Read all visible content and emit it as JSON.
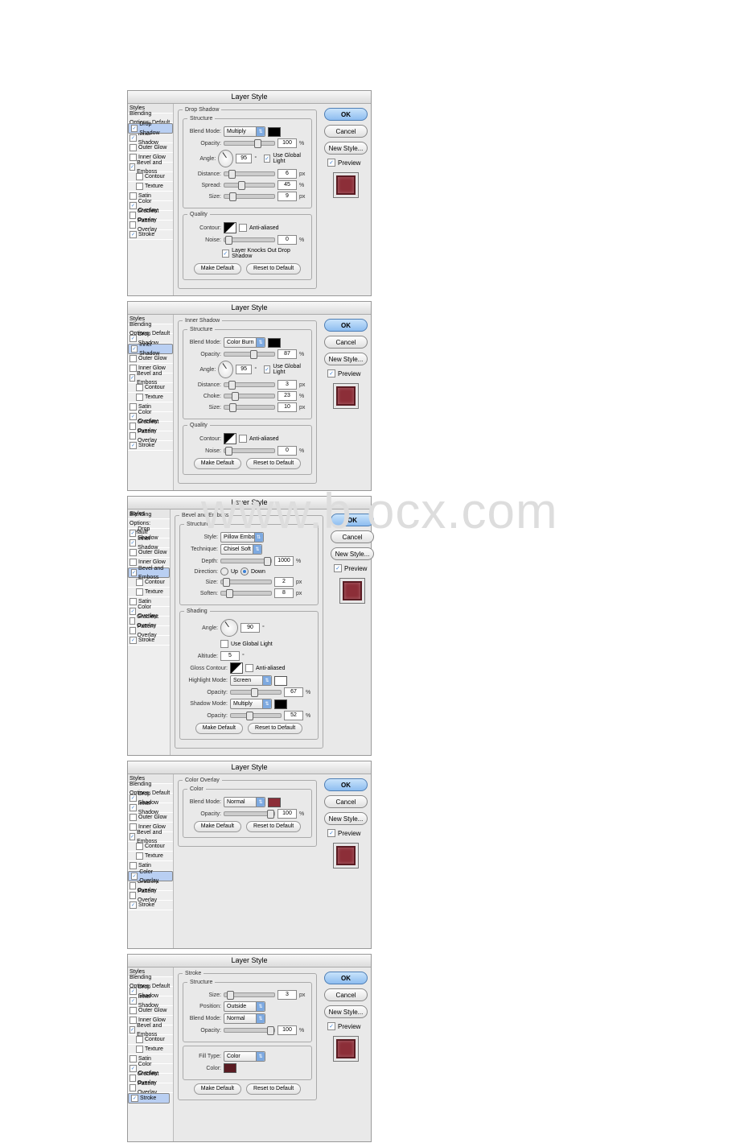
{
  "dialogs": [
    {
      "title": "Layer Style",
      "selected": "drop_shadow",
      "groupTitle": "Drop Shadow",
      "structure": {
        "blend_mode": "Multiply",
        "opacity": 100,
        "angle": 95,
        "use_global": true,
        "distance": 6,
        "distance_u": "px",
        "spread": 45,
        "spread_u": "%",
        "size": 9,
        "size_u": "px"
      },
      "quality": {
        "anti": false,
        "noise": 0,
        "knocks": true,
        "knocks_label": "Layer Knocks Out Drop Shadow"
      },
      "swatch": "#000000"
    },
    {
      "title": "Layer Style",
      "selected": "inner_shadow",
      "groupTitle": "Inner Shadow",
      "structure": {
        "blend_mode": "Color Burn",
        "opacity": 87,
        "angle": 95,
        "use_global": true,
        "distance": 3,
        "distance_u": "px",
        "choke": 23,
        "choke_u": "%",
        "size": 10,
        "size_u": "px",
        "choke_label": "Choke:"
      },
      "quality": {
        "anti": false,
        "noise": 0
      },
      "swatch": "#000000"
    },
    {
      "title": "Layer Style",
      "selected": "bevel",
      "groupTitle": "Bevel and Emboss",
      "bevel": {
        "style": "Pillow Emboss",
        "technique": "Chisel Soft",
        "depth": 1000,
        "direction": "down",
        "dir_up": "Up",
        "dir_down": "Down",
        "size": 2,
        "size_u": "px",
        "soften": 8,
        "soften_u": "px"
      },
      "shading": {
        "angle": 90,
        "use_global": false,
        "altitude": 5,
        "gloss_anti": false,
        "highlight_mode": "Screen",
        "highlight_op": 67,
        "shadow_mode": "Multiply",
        "shadow_op": 52,
        "gloss_label": "Gloss Contour:",
        "hl_label": "Highlight Mode:",
        "sh_label": "Shadow Mode:",
        "alt_label": "Altitude:"
      }
    },
    {
      "title": "Layer Style",
      "selected": "color_overlay",
      "groupTitle": "Color Overlay",
      "color": {
        "blend_mode": "Normal",
        "opacity": 100,
        "swatch": "#8c2e38",
        "legend": "Color"
      }
    },
    {
      "title": "Layer Style",
      "selected": "stroke",
      "groupTitle": "Stroke",
      "stroke": {
        "size": 3,
        "size_u": "px",
        "position": "Outside",
        "blend_mode": "Normal",
        "opacity": 100,
        "fill_type": "Color",
        "color": "#5a1b22",
        "fill_label": "Fill Type:",
        "color_label": "Color:"
      }
    }
  ],
  "sidebar": {
    "header": "Styles",
    "blending": "Blending Options: Default",
    "items": [
      {
        "key": "drop_shadow",
        "label": "Drop Shadow"
      },
      {
        "key": "inner_shadow",
        "label": "Inner Shadow"
      },
      {
        "key": "outer_glow",
        "label": "Outer Glow"
      },
      {
        "key": "inner_glow",
        "label": "Inner Glow"
      },
      {
        "key": "bevel",
        "label": "Bevel and Emboss"
      },
      {
        "key": "contour",
        "label": "Contour",
        "indent": true,
        "nocheck_on": true
      },
      {
        "key": "texture",
        "label": "Texture",
        "indent": true,
        "nocheck_on": true
      },
      {
        "key": "satin",
        "label": "Satin"
      },
      {
        "key": "color_overlay",
        "label": "Color Overlay"
      },
      {
        "key": "gradient_overlay",
        "label": "Gradient Overlay"
      },
      {
        "key": "pattern_overlay",
        "label": "Pattern Overlay"
      },
      {
        "key": "stroke",
        "label": "Stroke"
      }
    ],
    "checked": [
      "drop_shadow",
      "inner_shadow",
      "bevel",
      "color_overlay",
      "stroke"
    ]
  },
  "labels": {
    "structure": "Structure",
    "quality": "Quality",
    "shading": "Shading",
    "blend_mode": "Blend Mode:",
    "opacity": "Opacity:",
    "angle": "Angle:",
    "use_global": "Use Global Light",
    "distance": "Distance:",
    "spread": "Spread:",
    "size": "Size:",
    "soften": "Soften:",
    "contour": "Contour:",
    "anti": "Anti-aliased",
    "noise": "Noise:",
    "style": "Style:",
    "technique": "Technique:",
    "depth": "Depth:",
    "direction": "Direction:",
    "position": "Position:",
    "make_default": "Make Default",
    "reset_default": "Reset to Default",
    "ok": "OK",
    "cancel": "Cancel",
    "new_style": "New Style...",
    "preview": "Preview",
    "pct": "%",
    "deg": "°"
  },
  "watermark": "www.b    ocx.com"
}
